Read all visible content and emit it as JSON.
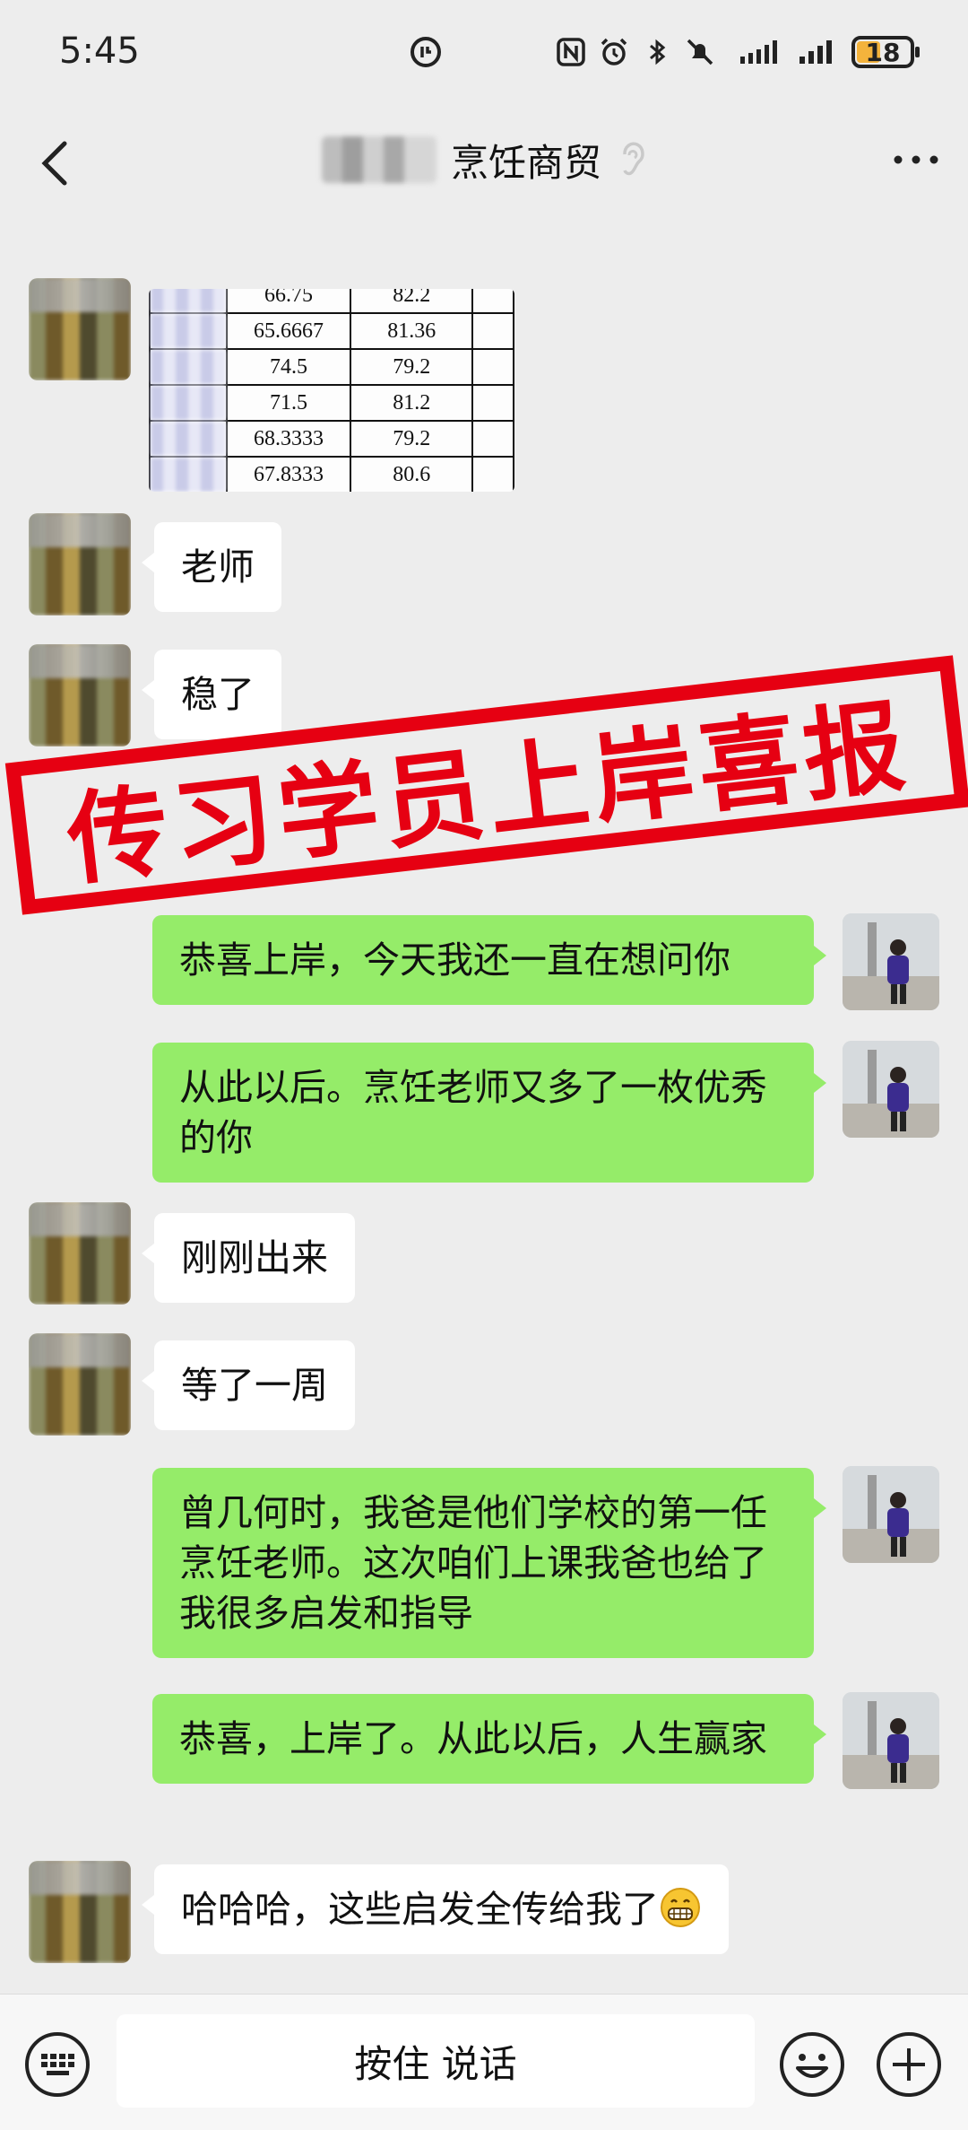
{
  "status_bar": {
    "time": "5:45",
    "battery": "18"
  },
  "header": {
    "title": "烹饪商贸",
    "back_icon": "chevron-left-icon",
    "more_icon": "more-horizontal-icon"
  },
  "stamp": {
    "text": "传习学员上岸喜报",
    "color": "#e60012"
  },
  "table_image": {
    "rows": [
      [
        "",
        "65.6667",
        "81.36"
      ],
      [
        "",
        "74.5",
        "79.2"
      ],
      [
        "",
        "71.5",
        "81.2"
      ],
      [
        "",
        "68.3333",
        "79.2"
      ],
      [
        "",
        "67.8333",
        "80.6"
      ]
    ]
  },
  "messages": [
    {
      "side": "left",
      "text": "老师"
    },
    {
      "side": "left",
      "text": "稳了"
    },
    {
      "side": "right",
      "text": "恭喜上岸，今天我还一直在想问你"
    },
    {
      "side": "right",
      "text": "从此以后。烹饪老师又多了一枚优秀的你"
    },
    {
      "side": "left",
      "text": "刚刚出来"
    },
    {
      "side": "left",
      "text": "等了一周"
    },
    {
      "side": "right",
      "text": "曾几何时，我爸是他们学校的第一任烹饪老师。这次咱们上课我爸也给了我很多启发和指导"
    },
    {
      "side": "right",
      "text": "恭喜，上岸了。从此以后，人生赢家"
    },
    {
      "side": "left",
      "text": "哈哈哈，这些启发全传给我了"
    }
  ],
  "input_bar": {
    "voice_label": "按住 说话"
  },
  "colors": {
    "background": "#ededed",
    "bubble_right": "#95ec69",
    "bubble_left": "#ffffff"
  }
}
